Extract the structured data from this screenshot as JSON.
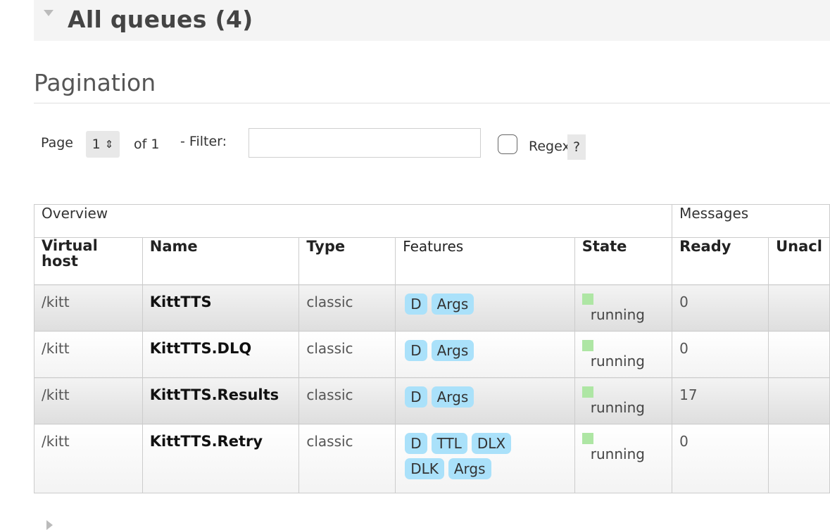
{
  "section": {
    "title": "All queues (4)"
  },
  "pagination": {
    "title": "Pagination",
    "page_label": "Page",
    "page_value": "1",
    "of_label": "of 1",
    "filter_label": "- Filter:",
    "filter_value": "",
    "regex_label": "Regex",
    "help_label": "?"
  },
  "table": {
    "groups": {
      "overview": "Overview",
      "messages": "Messages"
    },
    "columns": {
      "vhost": "Virtual host",
      "name": "Name",
      "type": "Type",
      "features": "Features",
      "state": "State",
      "ready": "Ready",
      "unacked": "Unacl"
    },
    "rows": [
      {
        "vhost": "/kitt",
        "name": "KittTTS",
        "type": "classic",
        "features": [
          "D",
          "Args"
        ],
        "state": "running",
        "ready": "0"
      },
      {
        "vhost": "/kitt",
        "name": "KittTTS.DLQ",
        "type": "classic",
        "features": [
          "D",
          "Args"
        ],
        "state": "running",
        "ready": "0"
      },
      {
        "vhost": "/kitt",
        "name": "KittTTS.Results",
        "type": "classic",
        "features": [
          "D",
          "Args"
        ],
        "state": "running",
        "ready": "17"
      },
      {
        "vhost": "/kitt",
        "name": "KittTTS.Retry",
        "type": "classic",
        "features": [
          "D",
          "TTL",
          "DLX",
          "DLK",
          "Args"
        ],
        "state": "running",
        "ready": "0"
      }
    ]
  },
  "colors": {
    "feature_tag": "#aae1fa",
    "state_running": "#aee6a4",
    "header_band": "#f4f4f4"
  }
}
